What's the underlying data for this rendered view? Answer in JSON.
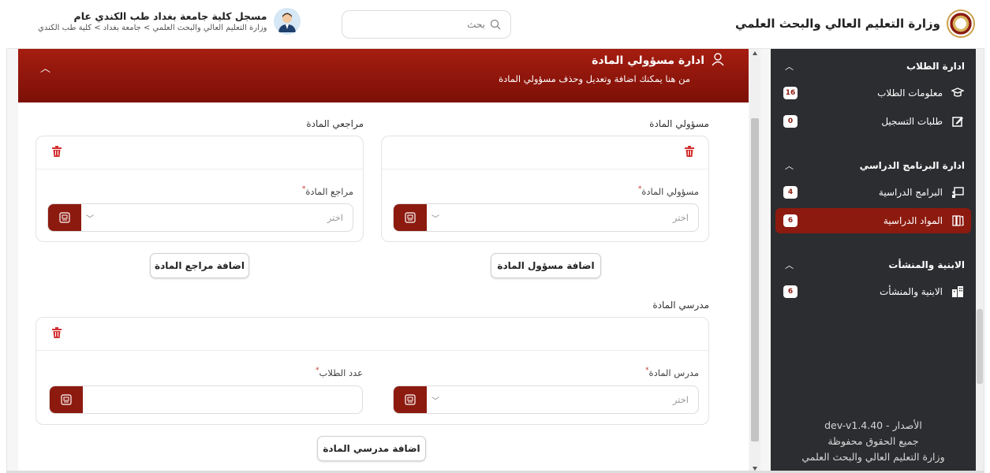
{
  "header": {
    "brand_title": "وزارة التعليم العالي والبحث العلمي",
    "search_placeholder": "بحث",
    "user_name": "مسجل كلية جامعة بغداد طب الكندي عام",
    "user_breadcrumb": "وزارة التعليم العالي والبحث العلمي > جامعة بغداد > كلية طب الكندي"
  },
  "sidebar": {
    "sections": [
      {
        "title": "ادارة الطلاب",
        "items": [
          {
            "label": "معلومات الطلاب",
            "badge": "16",
            "icon": "graduation-icon"
          },
          {
            "label": "طلبات التسجيل",
            "badge": "0",
            "icon": "edit-icon"
          }
        ]
      },
      {
        "title": "ادارة البرنامج الدراسي",
        "items": [
          {
            "label": "البرامج الدراسية",
            "badge": "4",
            "icon": "presentation-icon"
          },
          {
            "label": "المواد الدراسية",
            "badge": "6",
            "icon": "books-icon",
            "active": true
          }
        ]
      },
      {
        "title": "الابنية والمنشأت",
        "items": [
          {
            "label": "الابنية والمنشأت",
            "badge": "6",
            "icon": "building-icon"
          }
        ]
      }
    ],
    "footer": {
      "version": "الأصدار - dev-v1.4.40",
      "rights": "جميع الحقوق محفوظة",
      "org": "وزارة التعليم العالي والبحث العلمي"
    }
  },
  "main": {
    "banner": {
      "title": "ادارة مسؤولي المادة",
      "subtitle": "من هنا يمكنك اضافة وتعديل وحذف مسؤولي المادة"
    },
    "managers": {
      "section_label": "مسؤولي المادة",
      "field_label": "مسؤولي المادة",
      "select_placeholder": "اختر",
      "add_button": "اضافة مسؤول المادة"
    },
    "reviewers": {
      "section_label": "مراجعي المادة",
      "field_label": "مراجع المادة",
      "select_placeholder": "اختر",
      "add_button": "اضافة مراجع المادة"
    },
    "teachers": {
      "section_label": "مدرسي المادة",
      "teacher_field_label": "مدرس المادة",
      "teacher_placeholder": "اختر",
      "students_field_label": "عدد الطلاب",
      "students_value": "",
      "add_button": "اضافة مدرسي المادة"
    }
  },
  "colors": {
    "accent": "#8d1a0f",
    "sidebar_bg": "#2c2d30"
  }
}
